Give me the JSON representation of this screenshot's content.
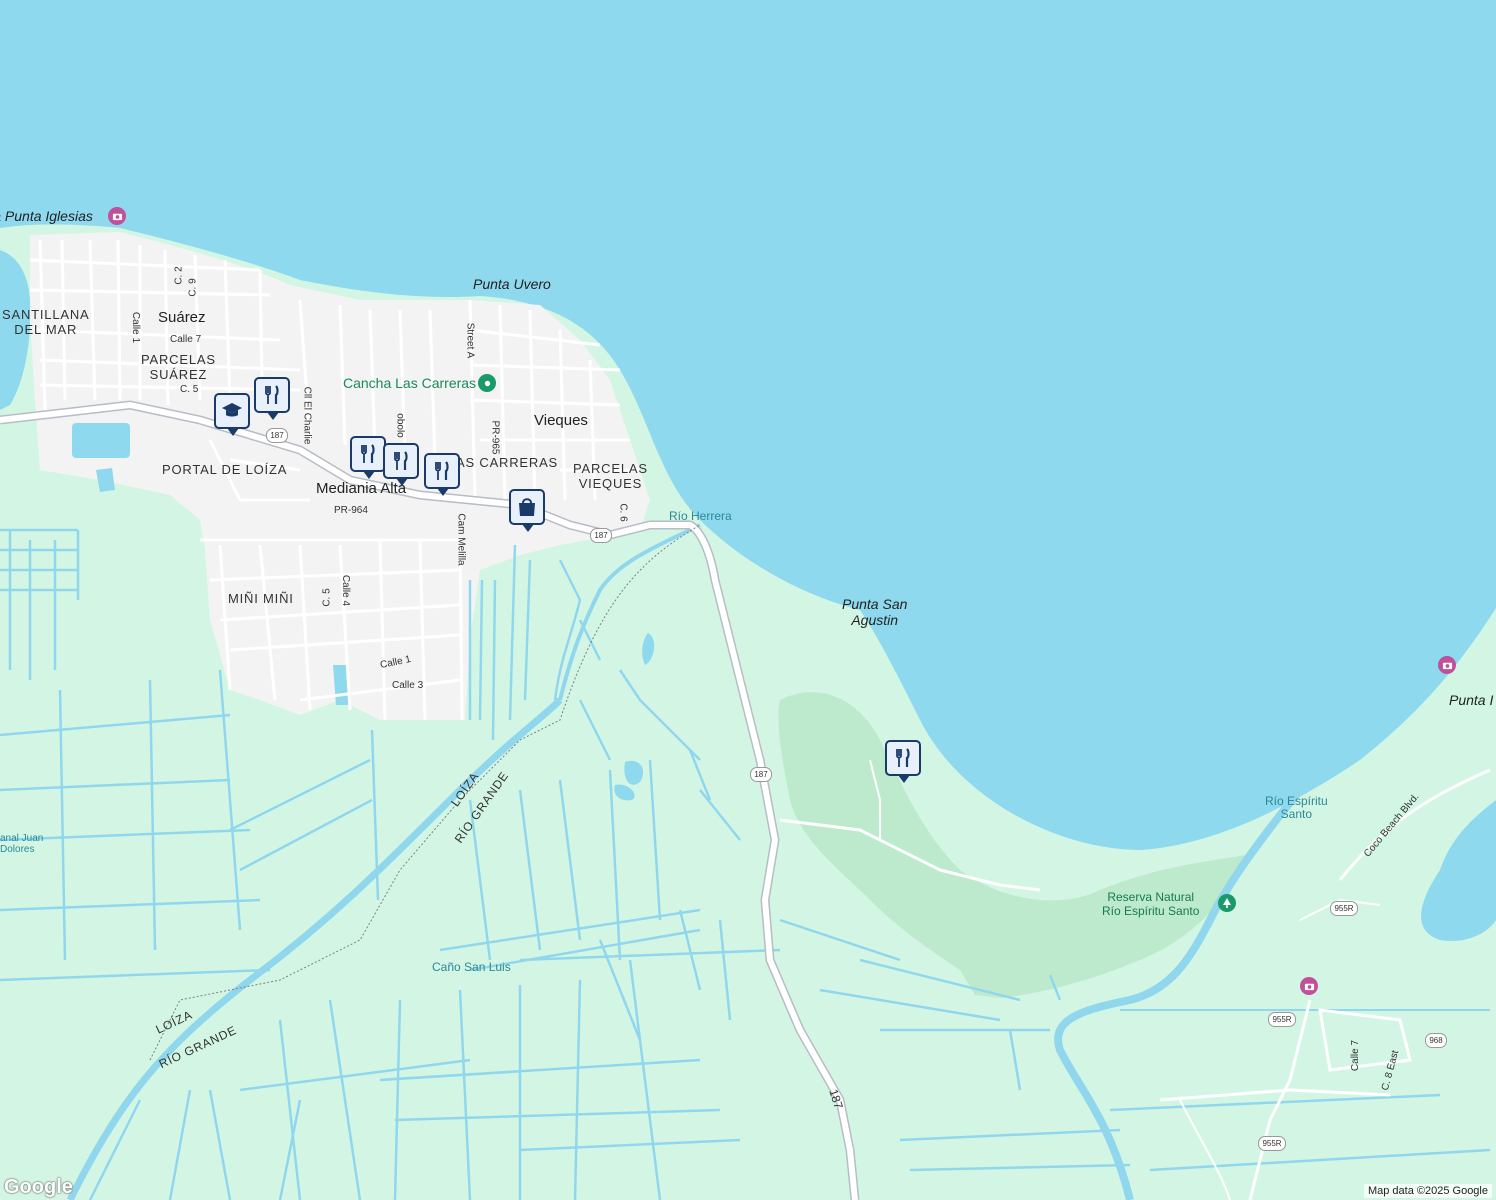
{
  "map": {
    "colors": {
      "sea": "#8fd9ee",
      "land": "#d3f6e4",
      "urban": "#f3f3f4",
      "park": "#bdeacd",
      "river": "#90d7ee",
      "road": "#ffffff",
      "highway_casing": "#b7bcc6",
      "pin_border": "#1a3a6a"
    },
    "labels": {
      "playa": "Playa Punta Iglesias",
      "punta_uvero": "Punta Uvero",
      "santillana": "SANTILLANA\nDEL MAR",
      "suarez": "Suárez",
      "parcelas_suarez": "PARCELAS\nSUÁREZ",
      "c2": "C. 2",
      "c9": "C. 9",
      "calle1_w": "Calle 1",
      "calle7": "Calle 7",
      "c5": "C. 5",
      "portal_loiza": "PORTAL DE LOÍZA",
      "cll_charlie": "Cll El Charlie",
      "obolo": "obolo",
      "mediania": "Mediania Alta",
      "las_carreras": "LAS CARRERAS",
      "pr964": "PR-964",
      "cam_melilla": "Cam Melilla",
      "street_a": "Street A",
      "cancha": "Cancha Las Carreras",
      "pr965": "PR-965",
      "vieques": "Vieques",
      "parcelas_vieques": "PARCELAS\nVIEQUES",
      "c6": "C. 6",
      "rio_herrera": "Río Herrera",
      "mini_mini": "MIÑI MIÑI",
      "c5b": "C. 5",
      "calle4": "Calle 4",
      "calle1": "Calle 1",
      "calle3": "Calle 3",
      "punta_san_agustin": "Punta San\nAgustin",
      "punta_partial": "Punta I",
      "rio_espiritu": "Río Espíritu\nSanto",
      "coco_beach": "Coco Beach Blvd.",
      "reserva": "Reserva Natural\nRío Espíritu Santo",
      "loiza_1": "LOÍZA",
      "rio_grande_1": "RÍO GRANDE",
      "loiza_2": "LOÍZA",
      "rio_grande_2": "RÍO GRANDE",
      "canal_juan": "anal Juan\nDolores",
      "cano_san_luis": "Caño San Luis",
      "calle7_e": "Calle 7",
      "c8_east": "C. 8 East",
      "route187_text": "187"
    },
    "shields": {
      "s187": "187",
      "s955r": "955R",
      "s968": "968"
    },
    "pins": [
      {
        "name": "school-pin",
        "icon": "school-icon"
      },
      {
        "name": "restaurant-pin",
        "icon": "fork-knife-icon"
      },
      {
        "name": "shopping-pin",
        "icon": "shopping-bag-icon"
      }
    ],
    "attribution": {
      "logo": "Google",
      "copyright": "Map data ©2025 Google"
    }
  }
}
